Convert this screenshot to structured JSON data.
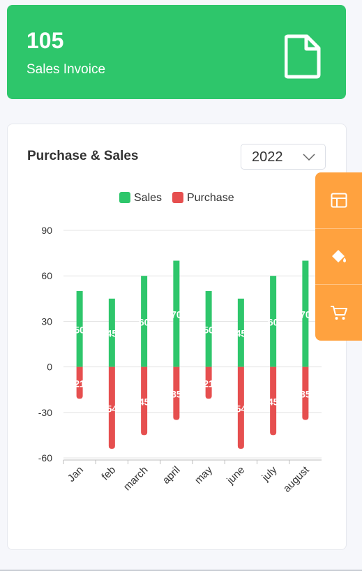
{
  "stat": {
    "value": "105",
    "label": "Sales Invoice",
    "icon": "file-icon"
  },
  "chart_card": {
    "title": "Purchase & Sales",
    "year": "2022"
  },
  "side_panel": {
    "icons": [
      "layout-icon",
      "paint-bucket-icon",
      "cart-icon"
    ]
  },
  "colors": {
    "sales": "#2ec66b",
    "purchase": "#e64f4f",
    "accent": "#ffa23f"
  },
  "chart_data": {
    "type": "bar",
    "categories": [
      "Jan",
      "feb",
      "march",
      "april",
      "may",
      "june",
      "july",
      "august"
    ],
    "series": [
      {
        "name": "Sales",
        "values": [
          50,
          45,
          60,
          70,
          50,
          45,
          60,
          70
        ],
        "labels": [
          "50",
          "45",
          "60",
          "70",
          "50",
          "45",
          "60",
          "70"
        ]
      },
      {
        "name": "Purchase",
        "values": [
          -21,
          -54,
          -45,
          -35,
          -21,
          -54,
          -45,
          -35
        ],
        "labels": [
          "21",
          "54",
          "45",
          "35",
          "21",
          "54",
          "45",
          "35"
        ]
      }
    ],
    "y_ticks": [
      "90",
      "60",
      "30",
      "0",
      "-30",
      "-60"
    ],
    "ylim": [
      -60,
      90
    ],
    "stacked": true,
    "legend": "top",
    "grid": true
  }
}
